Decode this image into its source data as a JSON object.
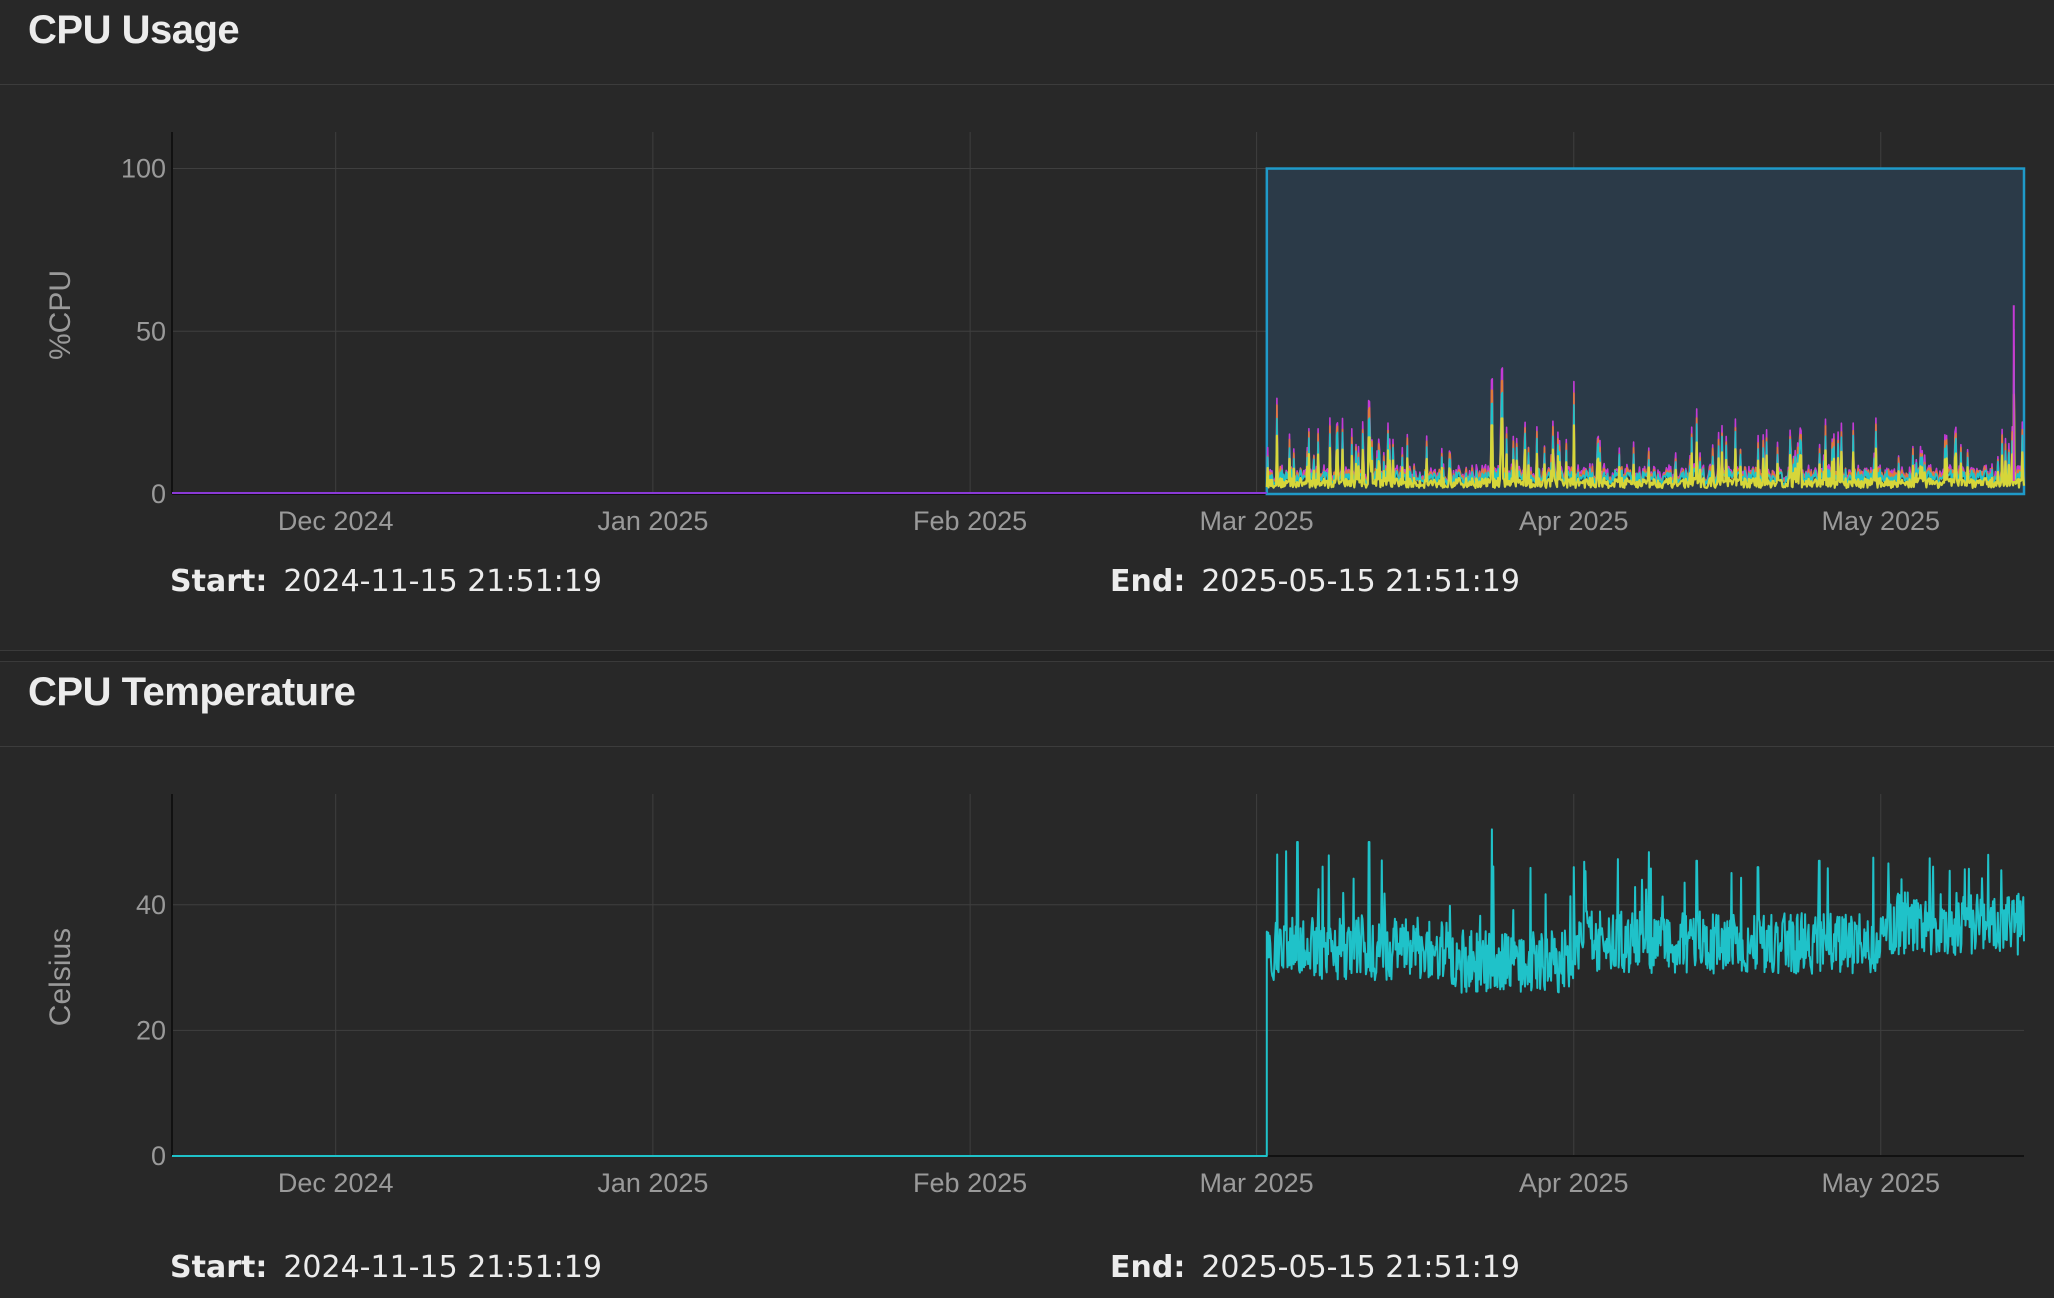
{
  "panels": [
    {
      "title": "CPU Usage",
      "start_label": "Start:",
      "start": "2024-11-15 21:51:19",
      "end_label": "End:",
      "end": "2025-05-15 21:51:19"
    },
    {
      "title": "CPU Temperature",
      "start_label": "Start:",
      "start": "2024-11-15 21:51:19",
      "end_label": "End:",
      "end": "2025-05-15 21:51:19"
    }
  ],
  "colors": {
    "background": "#282828",
    "grid": "#3f3f3f",
    "axis_text": "#9a9a9a",
    "usage_series": [
      "#d6d63a",
      "#1fc2c9",
      "#e07a3a",
      "#c43ad6"
    ],
    "usage_selection_fill": "#2b3a48",
    "usage_selection_stroke": "#1f9ac9",
    "temp_series": "#1fc2c9"
  },
  "chart_data": [
    {
      "type": "line",
      "title": "CPU Usage",
      "ylabel": "%CPU",
      "xlabel": "",
      "x_range": [
        "2024-11-15",
        "2025-05-15"
      ],
      "x_ticks": [
        "Dec 2024",
        "Jan 2025",
        "Feb 2025",
        "Mar 2025",
        "Apr 2025",
        "May 2025"
      ],
      "x_tick_dates": [
        "2024-12-01",
        "2025-01-01",
        "2025-02-01",
        "2025-03-01",
        "2025-04-01",
        "2025-05-01"
      ],
      "y_ticks": [
        "0",
        "50",
        "100"
      ],
      "ylim": [
        0,
        110
      ],
      "grid": true,
      "selection": {
        "x_start": "2025-03-02",
        "x_end": "2025-05-15",
        "y_max": 100
      },
      "data_start": "2025-03-02",
      "series": [
        {
          "values_summary": {
            "baseline": 5,
            "typical_peak": 15,
            "max": 38
          }
        },
        {
          "values_summary": {
            "baseline": 7,
            "typical_peak": 18,
            "max": 40
          }
        },
        {
          "values_summary": {
            "baseline": 8,
            "typical_peak": 20,
            "max": 42
          }
        },
        {
          "values_summary": {
            "baseline": 9,
            "typical_peak": 22,
            "max": 58
          }
        }
      ],
      "peaks": [
        {
          "x": "2025-03-03",
          "y": 34
        },
        {
          "x": "2025-03-12",
          "y": 33
        },
        {
          "x": "2025-03-24",
          "y": 40
        },
        {
          "x": "2025-03-25",
          "y": 44
        },
        {
          "x": "2025-04-01",
          "y": 40
        },
        {
          "x": "2025-04-13",
          "y": 30
        },
        {
          "x": "2025-05-14",
          "y": 58
        }
      ]
    },
    {
      "type": "line",
      "title": "CPU Temperature",
      "ylabel": "Celsius",
      "xlabel": "",
      "x_range": [
        "2024-11-15",
        "2025-05-15"
      ],
      "x_ticks": [
        "Dec 2024",
        "Jan 2025",
        "Feb 2025",
        "Mar 2025",
        "Apr 2025",
        "May 2025"
      ],
      "x_tick_dates": [
        "2024-12-01",
        "2025-01-01",
        "2025-02-01",
        "2025-03-01",
        "2025-04-01",
        "2025-05-01"
      ],
      "y_ticks": [
        "0",
        "20",
        "40"
      ],
      "ylim": [
        0,
        57
      ],
      "grid": true,
      "zero_until": "2025-03-02",
      "series": [
        {
          "values_summary": {
            "mean_mar": 33,
            "mean_late_mar": 31,
            "mean_apr": 34,
            "mean_may": 37,
            "min": 25,
            "max": 52
          }
        }
      ],
      "peaks": [
        {
          "x": "2025-03-03",
          "y": 48
        },
        {
          "x": "2025-03-05",
          "y": 50
        },
        {
          "x": "2025-03-12",
          "y": 50
        },
        {
          "x": "2025-03-24",
          "y": 52
        },
        {
          "x": "2025-04-01",
          "y": 46
        },
        {
          "x": "2025-04-13",
          "y": 47
        },
        {
          "x": "2025-04-19",
          "y": 46
        },
        {
          "x": "2025-04-25",
          "y": 47
        }
      ]
    }
  ]
}
